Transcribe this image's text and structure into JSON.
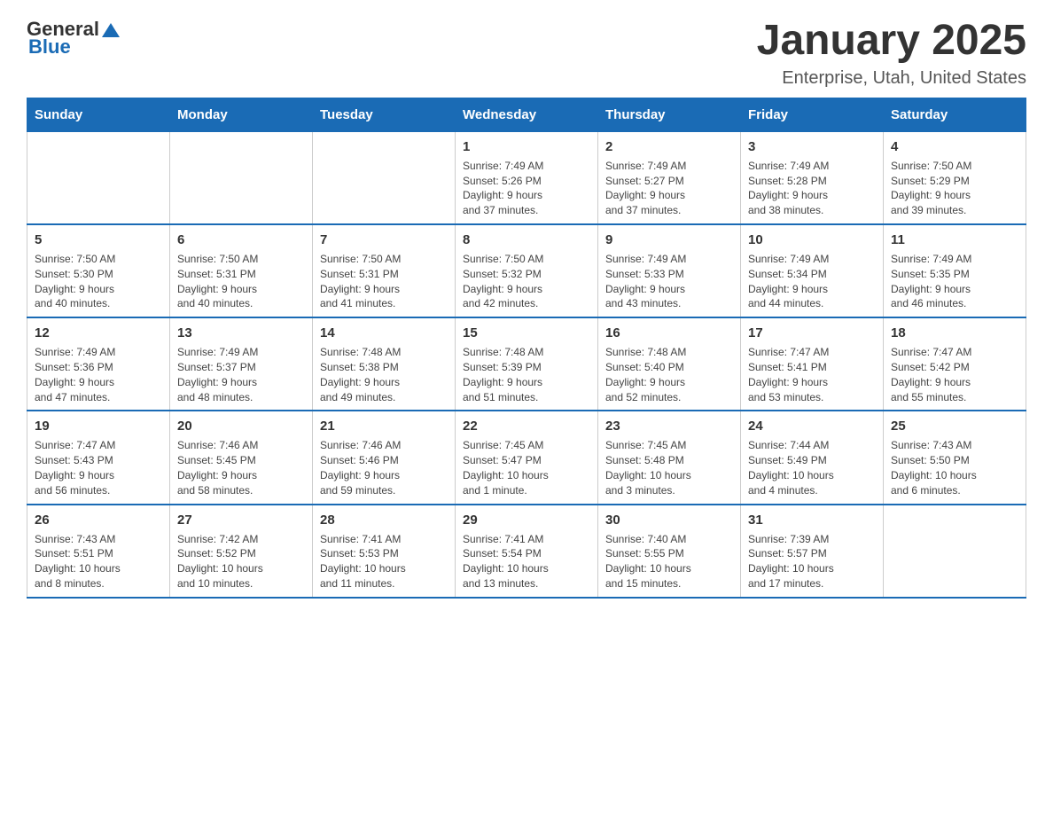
{
  "header": {
    "logo_general": "General",
    "logo_blue": "Blue",
    "title": "January 2025",
    "subtitle": "Enterprise, Utah, United States"
  },
  "weekdays": [
    "Sunday",
    "Monday",
    "Tuesday",
    "Wednesday",
    "Thursday",
    "Friday",
    "Saturday"
  ],
  "weeks": [
    [
      {
        "day": "",
        "info": ""
      },
      {
        "day": "",
        "info": ""
      },
      {
        "day": "",
        "info": ""
      },
      {
        "day": "1",
        "info": "Sunrise: 7:49 AM\nSunset: 5:26 PM\nDaylight: 9 hours\nand 37 minutes."
      },
      {
        "day": "2",
        "info": "Sunrise: 7:49 AM\nSunset: 5:27 PM\nDaylight: 9 hours\nand 37 minutes."
      },
      {
        "day": "3",
        "info": "Sunrise: 7:49 AM\nSunset: 5:28 PM\nDaylight: 9 hours\nand 38 minutes."
      },
      {
        "day": "4",
        "info": "Sunrise: 7:50 AM\nSunset: 5:29 PM\nDaylight: 9 hours\nand 39 minutes."
      }
    ],
    [
      {
        "day": "5",
        "info": "Sunrise: 7:50 AM\nSunset: 5:30 PM\nDaylight: 9 hours\nand 40 minutes."
      },
      {
        "day": "6",
        "info": "Sunrise: 7:50 AM\nSunset: 5:31 PM\nDaylight: 9 hours\nand 40 minutes."
      },
      {
        "day": "7",
        "info": "Sunrise: 7:50 AM\nSunset: 5:31 PM\nDaylight: 9 hours\nand 41 minutes."
      },
      {
        "day": "8",
        "info": "Sunrise: 7:50 AM\nSunset: 5:32 PM\nDaylight: 9 hours\nand 42 minutes."
      },
      {
        "day": "9",
        "info": "Sunrise: 7:49 AM\nSunset: 5:33 PM\nDaylight: 9 hours\nand 43 minutes."
      },
      {
        "day": "10",
        "info": "Sunrise: 7:49 AM\nSunset: 5:34 PM\nDaylight: 9 hours\nand 44 minutes."
      },
      {
        "day": "11",
        "info": "Sunrise: 7:49 AM\nSunset: 5:35 PM\nDaylight: 9 hours\nand 46 minutes."
      }
    ],
    [
      {
        "day": "12",
        "info": "Sunrise: 7:49 AM\nSunset: 5:36 PM\nDaylight: 9 hours\nand 47 minutes."
      },
      {
        "day": "13",
        "info": "Sunrise: 7:49 AM\nSunset: 5:37 PM\nDaylight: 9 hours\nand 48 minutes."
      },
      {
        "day": "14",
        "info": "Sunrise: 7:48 AM\nSunset: 5:38 PM\nDaylight: 9 hours\nand 49 minutes."
      },
      {
        "day": "15",
        "info": "Sunrise: 7:48 AM\nSunset: 5:39 PM\nDaylight: 9 hours\nand 51 minutes."
      },
      {
        "day": "16",
        "info": "Sunrise: 7:48 AM\nSunset: 5:40 PM\nDaylight: 9 hours\nand 52 minutes."
      },
      {
        "day": "17",
        "info": "Sunrise: 7:47 AM\nSunset: 5:41 PM\nDaylight: 9 hours\nand 53 minutes."
      },
      {
        "day": "18",
        "info": "Sunrise: 7:47 AM\nSunset: 5:42 PM\nDaylight: 9 hours\nand 55 minutes."
      }
    ],
    [
      {
        "day": "19",
        "info": "Sunrise: 7:47 AM\nSunset: 5:43 PM\nDaylight: 9 hours\nand 56 minutes."
      },
      {
        "day": "20",
        "info": "Sunrise: 7:46 AM\nSunset: 5:45 PM\nDaylight: 9 hours\nand 58 minutes."
      },
      {
        "day": "21",
        "info": "Sunrise: 7:46 AM\nSunset: 5:46 PM\nDaylight: 9 hours\nand 59 minutes."
      },
      {
        "day": "22",
        "info": "Sunrise: 7:45 AM\nSunset: 5:47 PM\nDaylight: 10 hours\nand 1 minute."
      },
      {
        "day": "23",
        "info": "Sunrise: 7:45 AM\nSunset: 5:48 PM\nDaylight: 10 hours\nand 3 minutes."
      },
      {
        "day": "24",
        "info": "Sunrise: 7:44 AM\nSunset: 5:49 PM\nDaylight: 10 hours\nand 4 minutes."
      },
      {
        "day": "25",
        "info": "Sunrise: 7:43 AM\nSunset: 5:50 PM\nDaylight: 10 hours\nand 6 minutes."
      }
    ],
    [
      {
        "day": "26",
        "info": "Sunrise: 7:43 AM\nSunset: 5:51 PM\nDaylight: 10 hours\nand 8 minutes."
      },
      {
        "day": "27",
        "info": "Sunrise: 7:42 AM\nSunset: 5:52 PM\nDaylight: 10 hours\nand 10 minutes."
      },
      {
        "day": "28",
        "info": "Sunrise: 7:41 AM\nSunset: 5:53 PM\nDaylight: 10 hours\nand 11 minutes."
      },
      {
        "day": "29",
        "info": "Sunrise: 7:41 AM\nSunset: 5:54 PM\nDaylight: 10 hours\nand 13 minutes."
      },
      {
        "day": "30",
        "info": "Sunrise: 7:40 AM\nSunset: 5:55 PM\nDaylight: 10 hours\nand 15 minutes."
      },
      {
        "day": "31",
        "info": "Sunrise: 7:39 AM\nSunset: 5:57 PM\nDaylight: 10 hours\nand 17 minutes."
      },
      {
        "day": "",
        "info": ""
      }
    ]
  ]
}
